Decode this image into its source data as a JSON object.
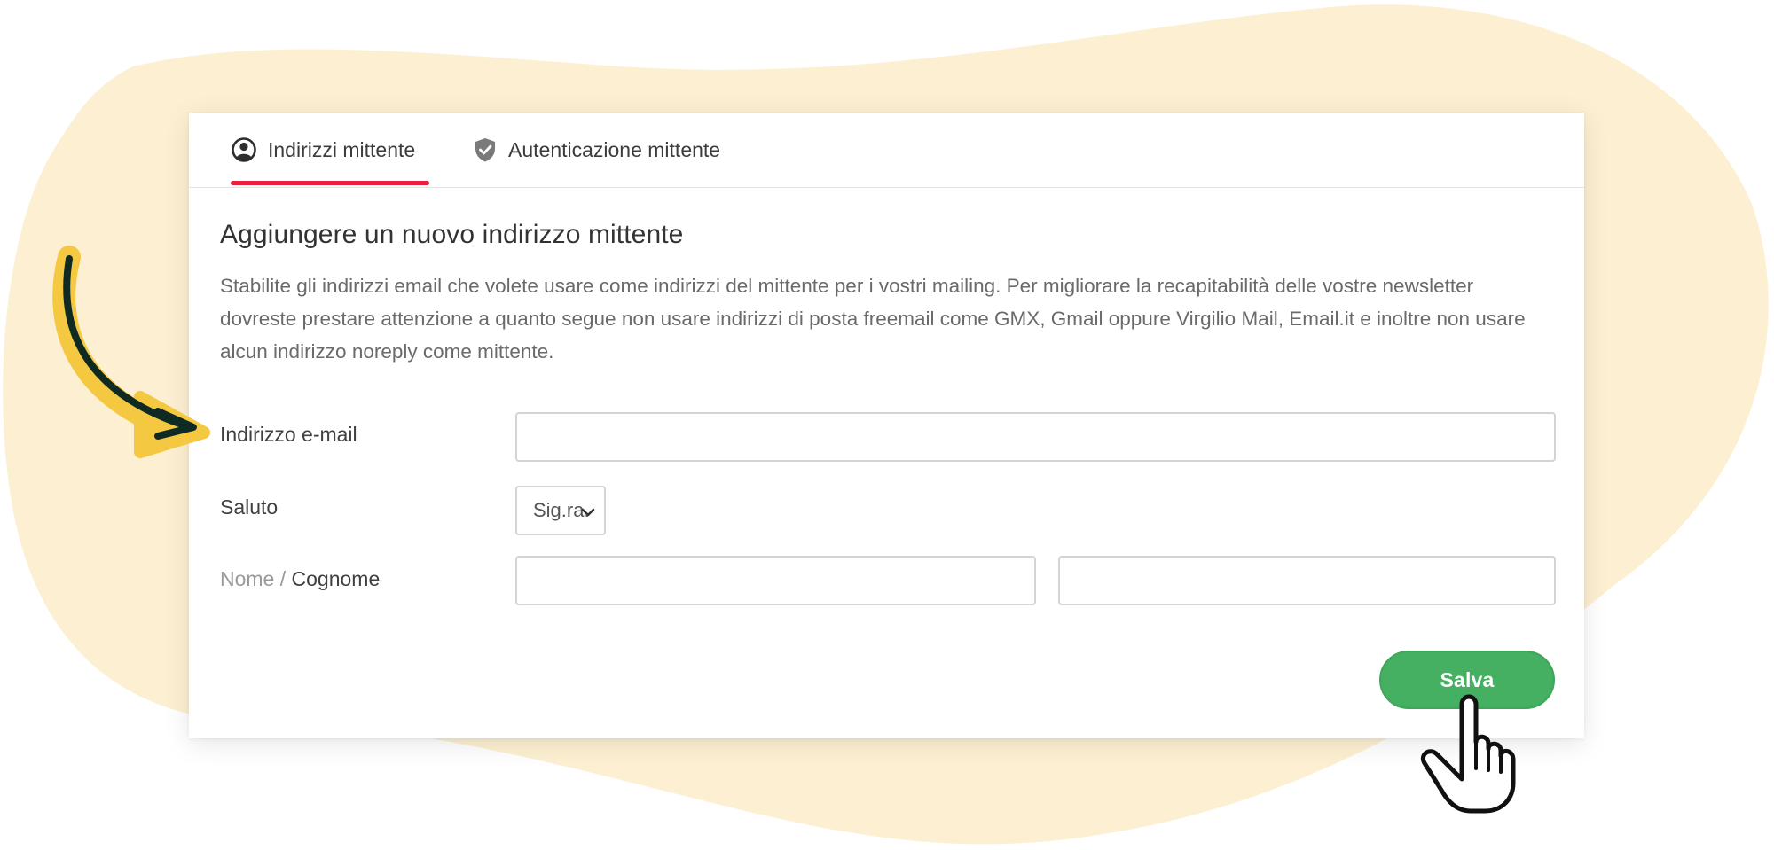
{
  "tabs": [
    {
      "label": "Indirizzi mittente",
      "icon": "user-circle-icon",
      "active": true
    },
    {
      "label": "Autenticazione mittente",
      "icon": "shield-check-icon",
      "active": false
    }
  ],
  "form": {
    "heading": "Aggiungere un nuovo indirizzo mittente",
    "description": "Stabilite gli indirizzi email che volete usare come indirizzi del mittente per i vostri mailing. Per migliorare la recapitabilità delle vostre newsletter dovreste prestare attenzione a quanto segue non usare indirizzi di posta freemail come GMX, Gmail oppure Virgilio Mail, Email.it e inoltre non usare alcun indirizzo noreply come mittente.",
    "email_label": "Indirizzo e-mail",
    "email_value": "",
    "salutation_label": "Saluto",
    "salutation_value": "Sig.ra.",
    "name_label_first": "Nome",
    "name_label_sep": " / ",
    "name_label_last": "Cognome",
    "first_name_value": "",
    "last_name_value": "",
    "save_label": "Salva"
  },
  "colors": {
    "accent_underline": "#e8203d",
    "save_button": "#45b062",
    "background_blob": "#fdf0d2",
    "arrow_yellow": "#f5c842",
    "arrow_dark": "#0f2a22"
  },
  "decorations": {
    "arrow": "curved-arrow-icon",
    "cursor": "hand-pointer-icon"
  }
}
